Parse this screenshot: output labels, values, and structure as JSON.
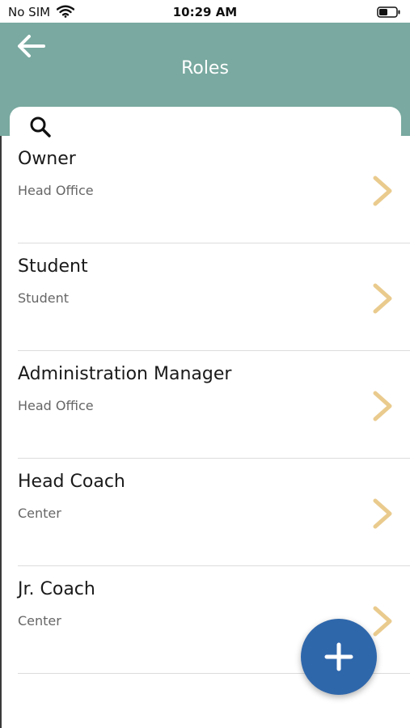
{
  "status_bar": {
    "carrier": "No SIM",
    "time": "10:29 AM"
  },
  "header": {
    "title": "Roles",
    "back_icon": "arrow-left-icon"
  },
  "search": {
    "placeholder": "",
    "value": "",
    "icon": "search-icon"
  },
  "roles": [
    {
      "name": "Owner",
      "location": "Head Office"
    },
    {
      "name": "Student",
      "location": "Student"
    },
    {
      "name": "Administration Manager",
      "location": "Head Office"
    },
    {
      "name": "Head Coach",
      "location": "Center"
    },
    {
      "name": "Jr. Coach",
      "location": "Center"
    }
  ],
  "fab": {
    "icon": "plus-icon"
  },
  "colors": {
    "header_bg": "#79a9a0",
    "chevron": "#eacb8e",
    "fab_bg": "#2f67ab",
    "subtitle": "#666666"
  }
}
